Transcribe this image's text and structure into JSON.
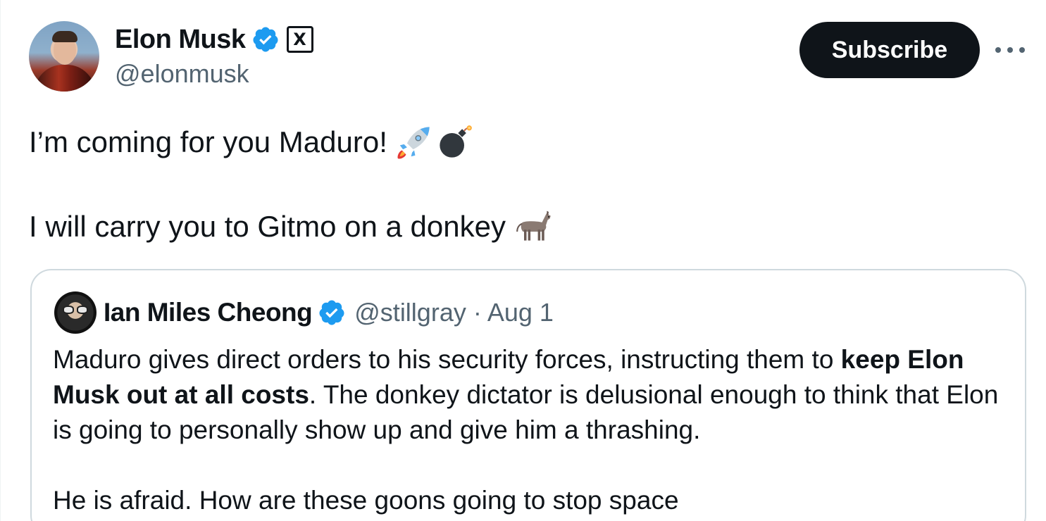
{
  "author": {
    "name": "Elon Musk",
    "handle": "@elonmusk",
    "verified": true,
    "affiliation_badge": "X"
  },
  "actions": {
    "subscribe_label": "Subscribe",
    "more_label": "···"
  },
  "tweet": {
    "line1": "I’m coming for you Maduro!",
    "line1_emojis": [
      "rocket-emoji",
      "bomb-emoji"
    ],
    "line2": "I will carry you to Gitmo on a donkey",
    "line2_emojis": [
      "donkey-emoji"
    ]
  },
  "quote": {
    "name": "Ian Miles Cheong",
    "verified": true,
    "meta": "@stillgray · Aug 1",
    "text_part1": "Maduro gives direct orders to his security forces, instructing them to ",
    "text_bold": "keep Elon Musk out at all costs",
    "text_part2": ". The donkey dictator is delusional enough to think that Elon is going to personally show up and give him a thrashing.",
    "text_para2": "He is afraid. How are these goons going to stop space"
  },
  "colors": {
    "verified_blue": "#1d9bf0",
    "text_primary": "#0f1419",
    "text_secondary": "#536471",
    "border": "#cfd9de"
  }
}
